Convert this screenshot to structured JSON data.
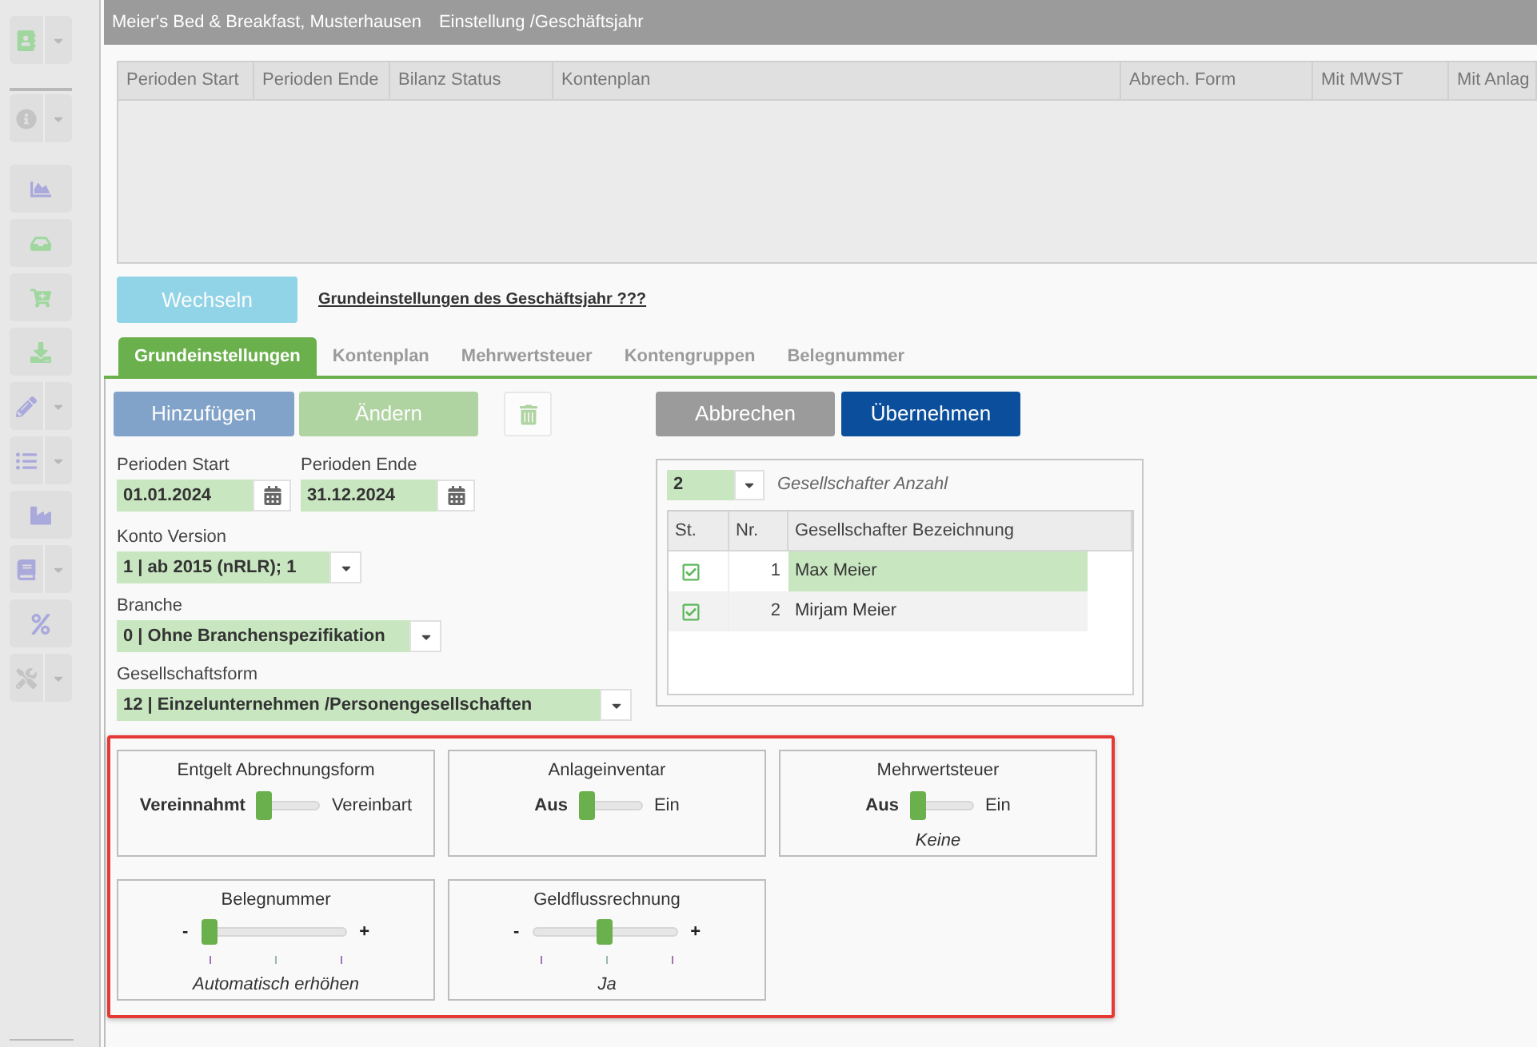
{
  "header": {
    "company": "Meier's Bed & Breakfast, Musterhausen",
    "section": "Einstellung /Geschäftsjahr"
  },
  "periods_table": {
    "columns": [
      "Perioden Start",
      "Perioden Ende",
      "Bilanz Status",
      "Kontenplan",
      "Abrech. Form",
      "Mit MWST",
      "Mit Anlag"
    ]
  },
  "switch_button": {
    "label": "Wechseln",
    "disabled": true
  },
  "settings_link": "Grundeinstellungen des Geschäftsjahr ???",
  "tabs": [
    {
      "label": "Grundeinstellungen",
      "selected": true
    },
    {
      "label": "Kontenplan",
      "selected": false
    },
    {
      "label": "Mehrwertsteuer",
      "selected": false
    },
    {
      "label": "Kontengruppen",
      "selected": false
    },
    {
      "label": "Belegnummer",
      "selected": false
    }
  ],
  "actions": [
    {
      "kind": "add",
      "label": "Hinzufügen",
      "disabled": true
    },
    {
      "kind": "edit",
      "label": "Ändern",
      "disabled": true
    },
    {
      "kind": "delete",
      "disabled": true
    },
    {
      "kind": "cancel",
      "label": "Abbrechen",
      "disabled": false
    },
    {
      "kind": "apply",
      "label": "Übernehmen",
      "disabled": false
    }
  ],
  "form": {
    "dates": [
      {
        "label": "Perioden Start",
        "value": "01.01.2024"
      },
      {
        "label": "Perioden Ende",
        "value": "31.12.2024"
      }
    ],
    "selects": [
      {
        "label": "Konto Version",
        "value": "1 | ab 2015 (nRLR); 1"
      },
      {
        "label": "Branche",
        "value": "0 | Ohne Branchenspezifikation"
      },
      {
        "label": "Gesellschaftsform",
        "value": "12 | Einzelunternehmen /Personengesellschaften"
      }
    ]
  },
  "partners": {
    "count": "2",
    "count_label": "Gesellschafter Anzahl",
    "columns": [
      "St.",
      "Nr.",
      "Gesellschafter Bezeichnung"
    ],
    "rows": [
      {
        "checked": true,
        "nr": "1",
        "name": "Max Meier",
        "selected": true
      },
      {
        "checked": true,
        "nr": "2",
        "name": "Mirjam Meier",
        "selected": false
      }
    ]
  },
  "settings": [
    {
      "kind": "toggle",
      "title": "Entgelt Abrechnungsform",
      "off_label": "Vereinnahmt",
      "on_label": "Vereinbart",
      "on": false
    },
    {
      "kind": "toggle",
      "title": "Anlageinventar",
      "off_label": "Aus",
      "on_label": "Ein",
      "on": false
    },
    {
      "kind": "toggle",
      "title": "Mehrwertsteuer",
      "off_label": "Aus",
      "on_label": "Ein",
      "on": false,
      "note": "Keine"
    },
    {
      "kind": "slider",
      "title": "Belegnummer",
      "min_label": "-",
      "max_label": "+",
      "level": 0,
      "note": "Automatisch erhöhen"
    },
    {
      "kind": "slider",
      "title": "Geldflussrechnung",
      "min_label": "-",
      "max_label": "+",
      "level": 0.5,
      "note": "Ja"
    }
  ]
}
